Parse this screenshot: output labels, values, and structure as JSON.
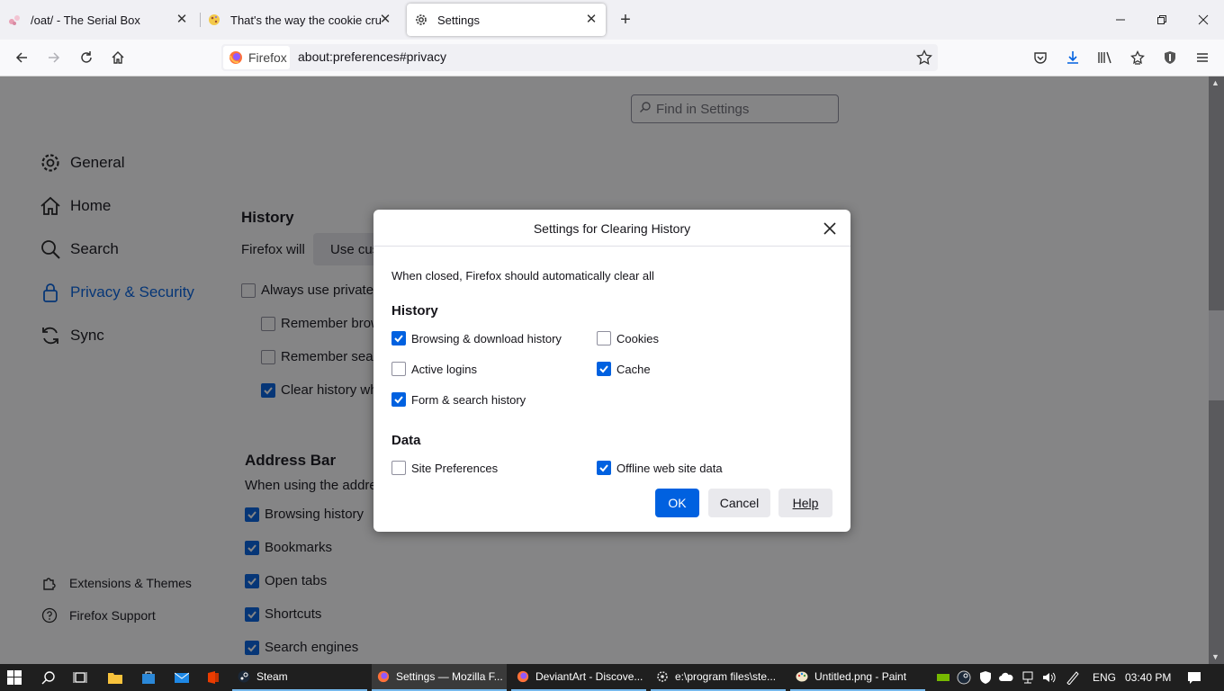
{
  "tabs": [
    {
      "title": "/oat/ - The Serial Box",
      "icon": "serial-box-favicon"
    },
    {
      "title": "That's the way the cookie crumbles",
      "icon": "cookie-favicon"
    },
    {
      "title": "Settings",
      "icon": "gear-icon",
      "active": true
    }
  ],
  "urlbar": {
    "identity": "Firefox",
    "url": "about:preferences#privacy"
  },
  "settings": {
    "find_placeholder": "Find in Settings",
    "categories": [
      {
        "label": "General",
        "icon": "gear-icon"
      },
      {
        "label": "Home",
        "icon": "home-icon"
      },
      {
        "label": "Search",
        "icon": "search-icon"
      },
      {
        "label": "Privacy & Security",
        "icon": "lock-icon",
        "selected": true
      },
      {
        "label": "Sync",
        "icon": "sync-icon"
      }
    ],
    "footer": [
      {
        "label": "Extensions & Themes",
        "icon": "puzzle-icon"
      },
      {
        "label": "Firefox Support",
        "icon": "help-icon"
      }
    ],
    "history": {
      "heading": "History",
      "firefox_will": "Firefox will",
      "mode_value": "Use cus",
      "options": [
        {
          "label": "Always use private",
          "checked": false
        },
        {
          "label": "Remember brow",
          "checked": false
        },
        {
          "label": "Remember sear",
          "checked": false
        },
        {
          "label": "Clear history wh",
          "checked": true
        }
      ]
    },
    "address_bar": {
      "heading": "Address Bar",
      "desc": "When using the addre",
      "options": [
        {
          "label": "Browsing history",
          "checked": true
        },
        {
          "label": "Bookmarks",
          "checked": true
        },
        {
          "label": "Open tabs",
          "checked": true
        },
        {
          "label": "Shortcuts",
          "checked": true
        },
        {
          "label": "Search engines",
          "checked": true
        }
      ]
    }
  },
  "dialog": {
    "title": "Settings for Clearing History",
    "intro": "When closed, Firefox should automatically clear all",
    "history_heading": "History",
    "history_items": [
      {
        "label": "Browsing & download history",
        "checked": true
      },
      {
        "label": "Cookies",
        "checked": false
      },
      {
        "label": "Active logins",
        "checked": false
      },
      {
        "label": "Cache",
        "checked": true
      },
      {
        "label": "Form & search history",
        "checked": true
      }
    ],
    "data_heading": "Data",
    "data_items": [
      {
        "label": "Site Preferences",
        "checked": false
      },
      {
        "label": "Offline web site data",
        "checked": true
      }
    ],
    "buttons": {
      "ok": "OK",
      "cancel": "Cancel",
      "help": "Help"
    },
    "accent": "#0061e0"
  },
  "taskbar": {
    "apps": [
      {
        "label": "Steam",
        "icon": "steam-icon"
      },
      {
        "label": "Settings — Mozilla F...",
        "icon": "firefox-icon",
        "active": true
      },
      {
        "label": "DeviantArt - Discove...",
        "icon": "firefox-icon"
      },
      {
        "label": "e:\\program files\\ste...",
        "icon": "gear-icon"
      },
      {
        "label": "Untitled.png - Paint",
        "icon": "paint-icon"
      }
    ],
    "lang": "ENG",
    "time": "03:40 PM"
  }
}
